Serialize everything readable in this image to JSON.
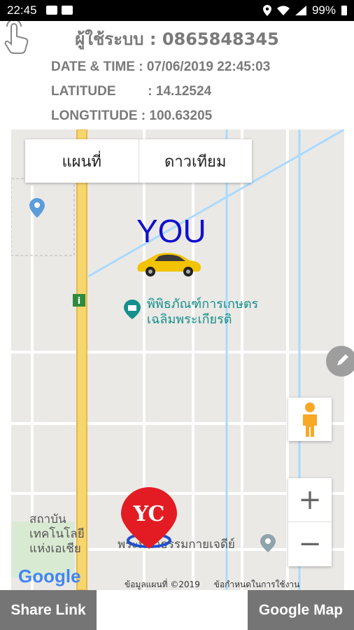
{
  "status_bar": {
    "time": "22:45",
    "battery": "99%",
    "icons": [
      "notification-icon",
      "youtube-icon",
      "location-icon",
      "wifi-icon",
      "signal-icon",
      "battery-icon"
    ]
  },
  "info": {
    "user": "ผู้ใช้ระบบ : 0865848345",
    "datetime_label": "DATE & TIME",
    "datetime_value": ": 07/06/2019 22:45:03",
    "latitude_label": "LATITUDE",
    "latitude_value": ": 14.12524",
    "longitude_label": "LONGTITUDE",
    "longitude_value": ": 100.63205"
  },
  "map": {
    "tab_map": "แผนที่",
    "tab_satellite": "ดาวเทียม",
    "you_label": "YOU",
    "poi_museum": "พิพิธภัณฑ์การเกษตร\nเฉลิมพระเกียรติ",
    "poi_temple": "พระมหาธรรมกายเจดีย์",
    "poi_institute": "สถาบัน\nเทคโนโลยี\nแห่งเอเชีย",
    "marker_text": "YC",
    "attribution_data": "ข้อมูลแผนที่ ©2019",
    "attribution_terms": "ข้อกำหนดในการใช้งาน",
    "zoom_in": "+",
    "zoom_out": "−",
    "google_logo": "Google"
  },
  "colors": {
    "you_text": "#1111cc",
    "button_bg": "#757575",
    "marker_red": "#e31c23",
    "map_bg": "#ebe9e6",
    "road_yellow": "#f7d66e"
  },
  "buttons": {
    "share": "Share Link",
    "google_map": "Google Map"
  }
}
